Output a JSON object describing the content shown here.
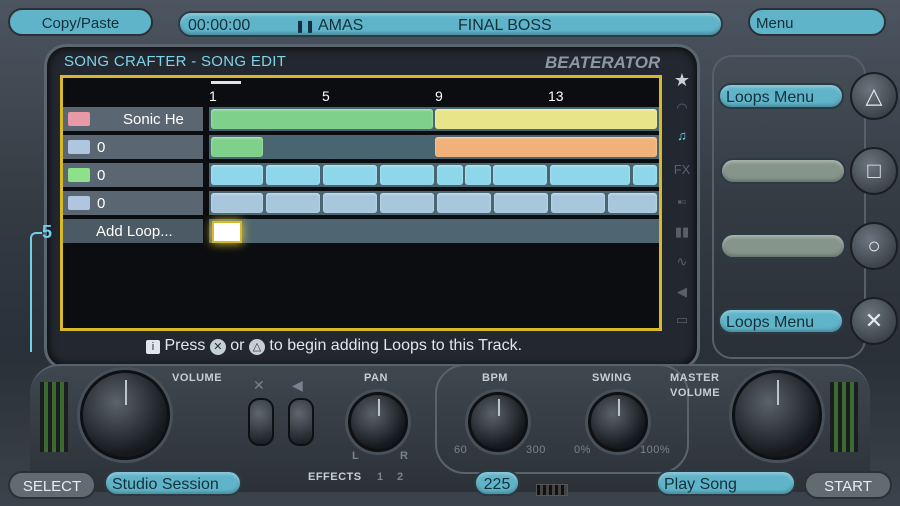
{
  "top": {
    "copy_paste": "Copy/Paste",
    "time": "00:00:00",
    "pause_glyph": "❚❚",
    "artist": "AMAS",
    "song_title": "FINAL BOSS",
    "menu": "Menu"
  },
  "screen": {
    "header": "SONG CRAFTER - SONG EDIT",
    "logo": "BEATERATOR",
    "ruler": [
      "1",
      "5",
      "9",
      "13"
    ],
    "track_count": "5",
    "tracks": [
      {
        "label": "Sonic He",
        "icon": "keyboard-icon"
      },
      {
        "label": "0",
        "icon": "drum-icon"
      },
      {
        "label": "0",
        "icon": "keyboard-icon"
      },
      {
        "label": "0",
        "icon": "drum-icon"
      }
    ],
    "add_loop": "Add Loop...",
    "hint": {
      "prefix": "Press",
      "or": "or",
      "suffix": "to begin adding Loops to this Track."
    }
  },
  "side": {
    "loops_menu_top": "Loops Menu",
    "loops_menu_bottom": "Loops Menu",
    "triangle": "△",
    "square": "□",
    "circle": "○",
    "cross": "✕"
  },
  "bottom": {
    "select": "SELECT",
    "studio": "Studio Session",
    "volume": "VOLUME",
    "pan": "PAN",
    "pan_l": "L",
    "pan_r": "R",
    "effects": "EFFECTS",
    "fx1": "1",
    "fx2": "2",
    "bpm": "BPM",
    "bpm_min": "60",
    "bpm_max": "300",
    "bpm_value": "225",
    "swing": "SWING",
    "swing_min": "0%",
    "swing_max": "100%",
    "master_volume_1": "MASTER",
    "master_volume_2": "VOLUME",
    "play_song": "Play Song",
    "start": "START"
  },
  "colors": {
    "accent": "#5fb4c9",
    "selection": "#d7b92a",
    "green": "#7fd08a",
    "yellow": "#e8e48a",
    "orange": "#f0b278",
    "cyan": "#8ed6ea",
    "blue": "#a8c6dc"
  }
}
